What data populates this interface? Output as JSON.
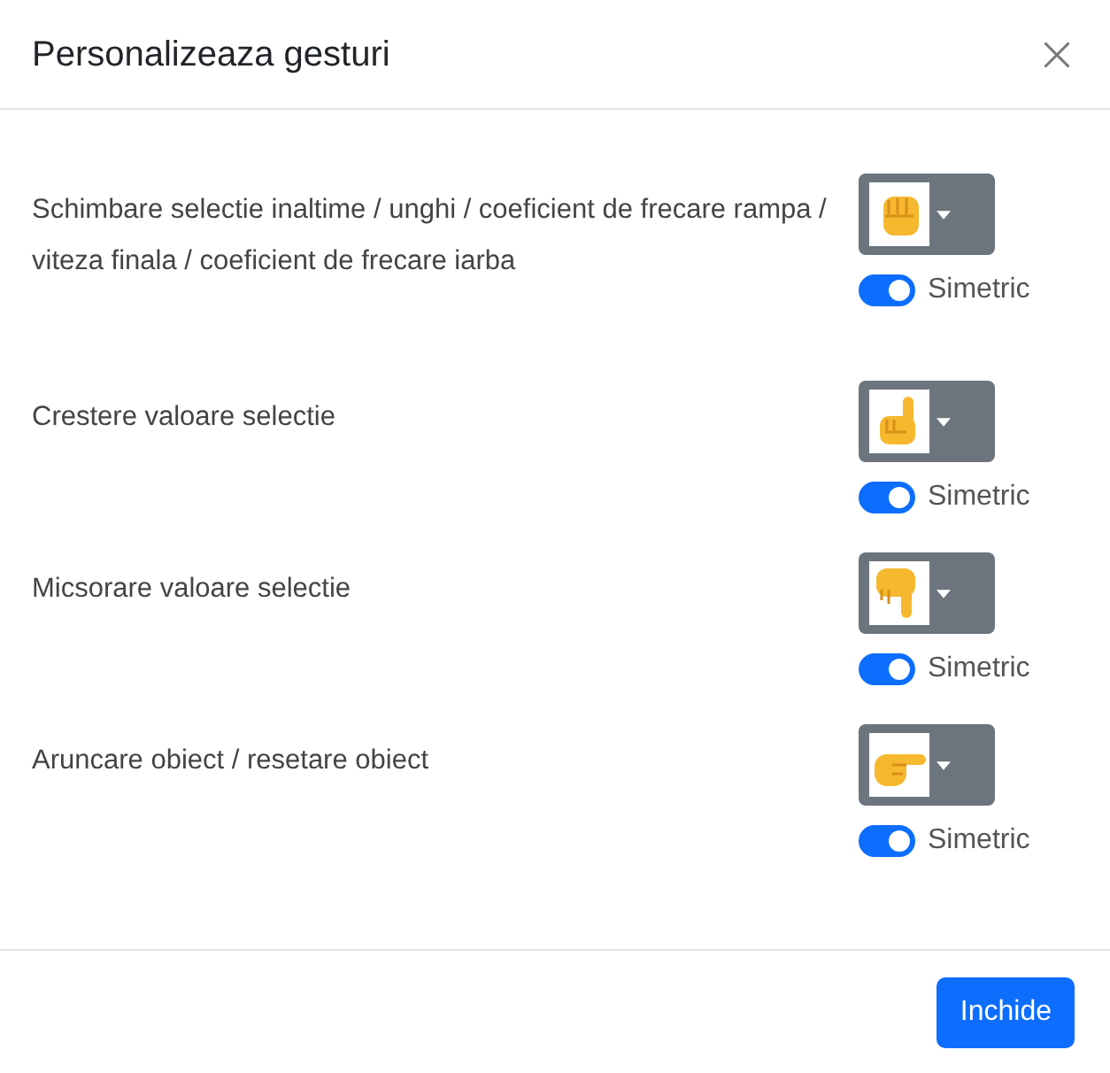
{
  "title": "Personalizeaza gesturi",
  "rows": [
    {
      "label": "Schimbare selectie inaltime / unghi / coeficient de frecare rampa / viteza finala / coeficient de frecare iarba",
      "gesture": {
        "kind": "fist"
      },
      "toggle": {
        "label": "Simetric",
        "on": true
      }
    },
    {
      "label": "Crestere valoare selectie",
      "gesture": {
        "kind": "point-up"
      },
      "toggle": {
        "label": "Simetric",
        "on": true
      }
    },
    {
      "label": "Micsorare valoare selectie",
      "gesture": {
        "kind": "point-down"
      },
      "toggle": {
        "label": "Simetric",
        "on": true
      }
    },
    {
      "label": "Aruncare obiect / resetare obiect",
      "gesture": {
        "kind": "point-right"
      },
      "toggle": {
        "label": "Simetric",
        "on": true
      }
    }
  ],
  "close_button": "Inchide"
}
